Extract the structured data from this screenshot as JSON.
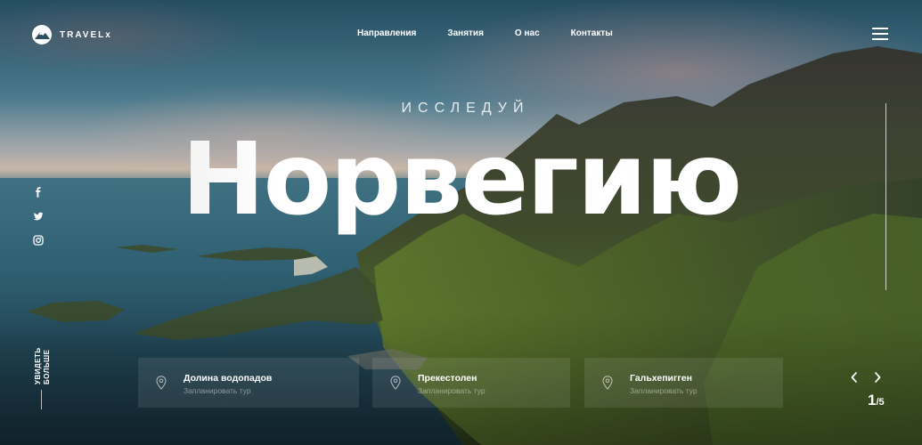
{
  "brand": {
    "name": "TRAVELx"
  },
  "nav": {
    "items": [
      "Направления",
      "Занятия",
      "О нас",
      "Контакты"
    ]
  },
  "hero": {
    "subtitle": "ИССЛЕДУЙ",
    "headline": "Норвегию"
  },
  "social": {
    "icons": [
      "facebook-icon",
      "twitter-icon",
      "instagram-icon"
    ]
  },
  "see_more": {
    "label": "УВИДЕТЬ БОЛЬШЕ"
  },
  "destinations": [
    {
      "title": "Долина водопадов",
      "subtitle": "Запланировать тур"
    },
    {
      "title": "Прекестолен",
      "subtitle": "Запланировать тур"
    },
    {
      "title": "Гальхепигген",
      "subtitle": "Запланировать тур"
    }
  ],
  "slider": {
    "current": "1",
    "separator": "/",
    "total": "5"
  },
  "colors": {
    "text": "#ffffff",
    "card_bg": "rgba(255,255,255,0.09)"
  }
}
